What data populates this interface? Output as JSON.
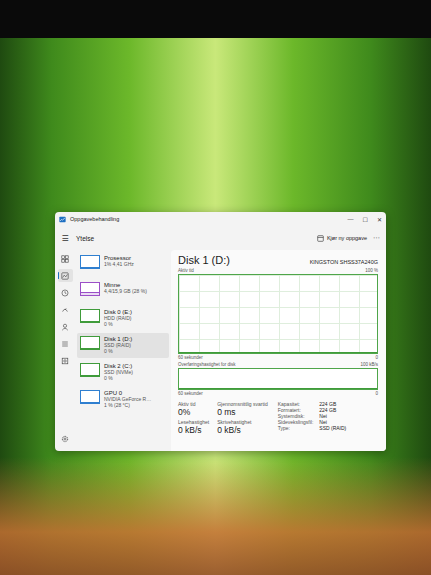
{
  "window": {
    "title": "Oppgavebehandling",
    "controls": [
      "—",
      "☐",
      "✕"
    ]
  },
  "toolbar": {
    "menu_icon": "☰",
    "page_title": "Ytelse",
    "action": "Kjør ny oppgave",
    "more": "⋯"
  },
  "nav": [
    {
      "selected": false
    },
    {
      "selected": true
    },
    {
      "selected": false
    },
    {
      "selected": false
    },
    {
      "selected": false
    },
    {
      "selected": false
    },
    {
      "selected": false
    }
  ],
  "sidebar": {
    "items": [
      {
        "name": "Prosessor",
        "details": [
          "1% 4,41 GHz"
        ],
        "selected": false,
        "color": "#2f7fd0",
        "level": 0.01
      },
      {
        "name": "Minne",
        "details": [
          "4,4/15,9 GB (28 %)"
        ],
        "selected": false,
        "color": "#9b4fc7",
        "level": 0.28
      },
      {
        "name": "Disk 0 (E:)",
        "details": [
          "HDD (RAID)",
          "0 %"
        ],
        "selected": false,
        "color": "#3f9b3a",
        "level": 0
      },
      {
        "name": "Disk 1 (D:)",
        "details": [
          "SSD (RAID)",
          "0 %"
        ],
        "selected": true,
        "color": "#3f9b3a",
        "level": 0
      },
      {
        "name": "Disk 2 (C:)",
        "details": [
          "SSD (NVMe)",
          "0 %"
        ],
        "selected": false,
        "color": "#3f9b3a",
        "level": 0
      },
      {
        "name": "GPU 0",
        "details": [
          "NVIDIA GeForce R…",
          "1 % (28 °C)"
        ],
        "selected": false,
        "color": "#2f7fd0",
        "level": 0.01
      }
    ]
  },
  "detail": {
    "title": "Disk 1 (D:)",
    "model": "KINGSTON SHSS37A240G",
    "charts": [
      {
        "title": "Aktiv tid",
        "max": "100 %",
        "span": "60 sekunder",
        "min": "0",
        "scale_max": 100,
        "values": [
          0,
          0,
          0,
          0,
          0,
          0,
          0,
          0,
          0,
          0,
          0,
          0
        ]
      },
      {
        "title": "Overføringshastighet for disk",
        "max": "100 kB/s",
        "span": "60 sekunder",
        "min": "0",
        "scale_max": 100,
        "values": [
          0,
          0,
          0,
          0,
          0,
          0,
          0,
          0,
          0,
          0,
          0,
          0
        ]
      }
    ],
    "stats": [
      {
        "label": "Aktiv tid",
        "value": "0%"
      },
      {
        "label": "Gjennomsnittlig svartid",
        "value": "0 ms"
      },
      {
        "label": "Lesehastighet",
        "value": "0 kB/s"
      },
      {
        "label": "Skrivehastighet",
        "value": "0 kB/s"
      }
    ],
    "properties": [
      {
        "label": "Kapasitet:",
        "value": "224 GB"
      },
      {
        "label": "Formatert:",
        "value": "224 GB"
      },
      {
        "label": "Systemdisk:",
        "value": "Nei"
      },
      {
        "label": "Sidevekslingsfil:",
        "value": "Nei"
      },
      {
        "label": "Type:",
        "value": "SSD (RAID)"
      }
    ]
  }
}
